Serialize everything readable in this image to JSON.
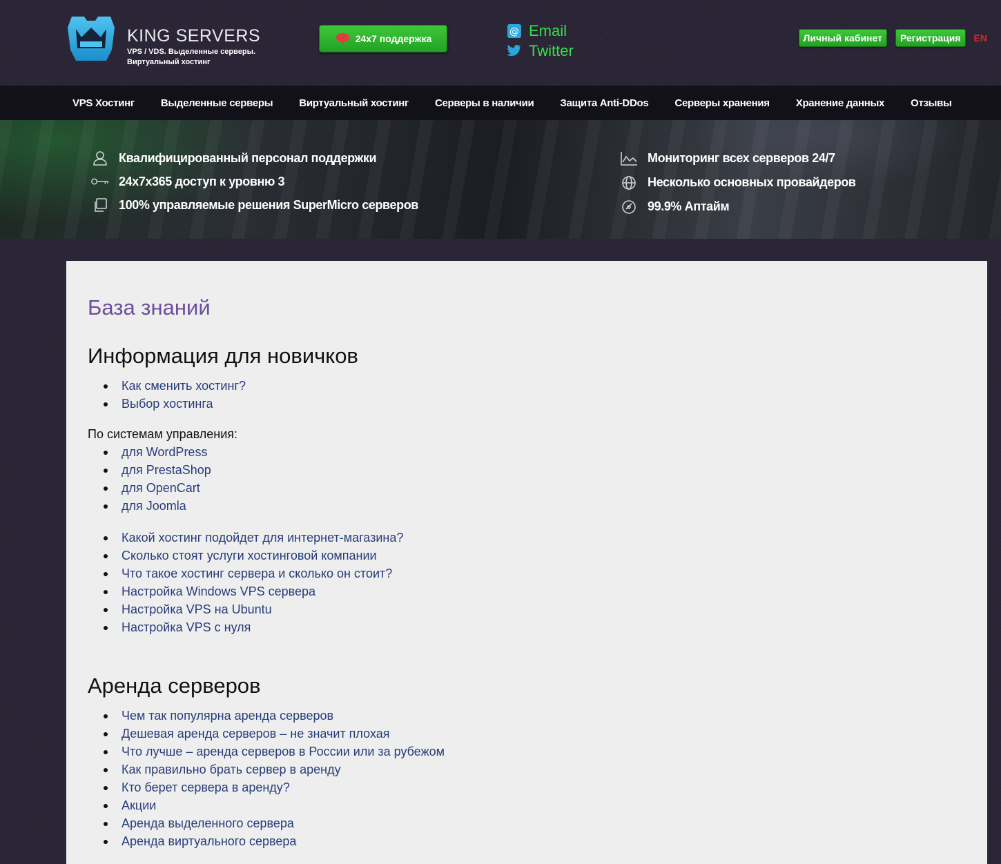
{
  "header": {
    "brand_title": "KING SERVERS",
    "brand_subtitle_1": "VPS / VDS. Выделенные серверы.",
    "brand_subtitle_2": "Виртуальный хостинг",
    "support_label": "24x7 поддержка",
    "email_label": "Email",
    "twitter_label": "Twitter",
    "cabinet_label": "Личный кабинет",
    "register_label": "Регистрация",
    "lang_label": "EN"
  },
  "nav": [
    "VPS Хостинг",
    "Выделенные серверы",
    "Виртуальный хостинг",
    "Серверы в наличии",
    "Защита Anti-DDos",
    "Серверы хранения",
    "Хранение данных",
    "Отзывы"
  ],
  "banner": {
    "left": [
      "Квалифицированный персонал поддержки",
      "24x7x365 доступ к уровню 3",
      "100% управляемые решения SuperMicro серверов"
    ],
    "right": [
      "Мониторинг всех серверов 24/7",
      "Несколько основных провайдеров",
      "99.9% Аптайм"
    ]
  },
  "content": {
    "kb_title": "База знаний",
    "section1_title": "Информация для новичков",
    "section1_list": [
      "Как сменить хостинг?",
      "Выбор хостинга"
    ],
    "cms_label": "По системам управления:",
    "cms_list": [
      "для WordPress",
      "для PrestaShop",
      "для OpenCart",
      "для Joomla"
    ],
    "more_list": [
      "Какой хостинг подойдет для интернет-магазина?",
      "Сколько стоят услуги хостинговой компании",
      "Что такое хостинг сервера и сколько он стоит?",
      "Настройка Windows VPS сервера",
      "Настройка VPS на Ubuntu",
      "Настройка VPS с нуля"
    ],
    "section2_title": "Аренда серверов",
    "section2_list": [
      "Чем так популярна аренда серверов",
      "Дешевая аренда серверов – не значит плохая",
      "Что лучше – аренда серверов в России или за рубежом",
      "Как правильно брать сервер в аренду",
      "Кто берет сервера в аренду?",
      "Акции",
      "Аренда выделенного сервера",
      "Аренда виртуального сервера"
    ]
  },
  "colors": {
    "accent_green": "#2fb52d",
    "link_blue": "#273d7a",
    "kb_purple": "#6c4f9b",
    "lang_red": "#e2231a",
    "logo_blue": "#2aa6de"
  }
}
